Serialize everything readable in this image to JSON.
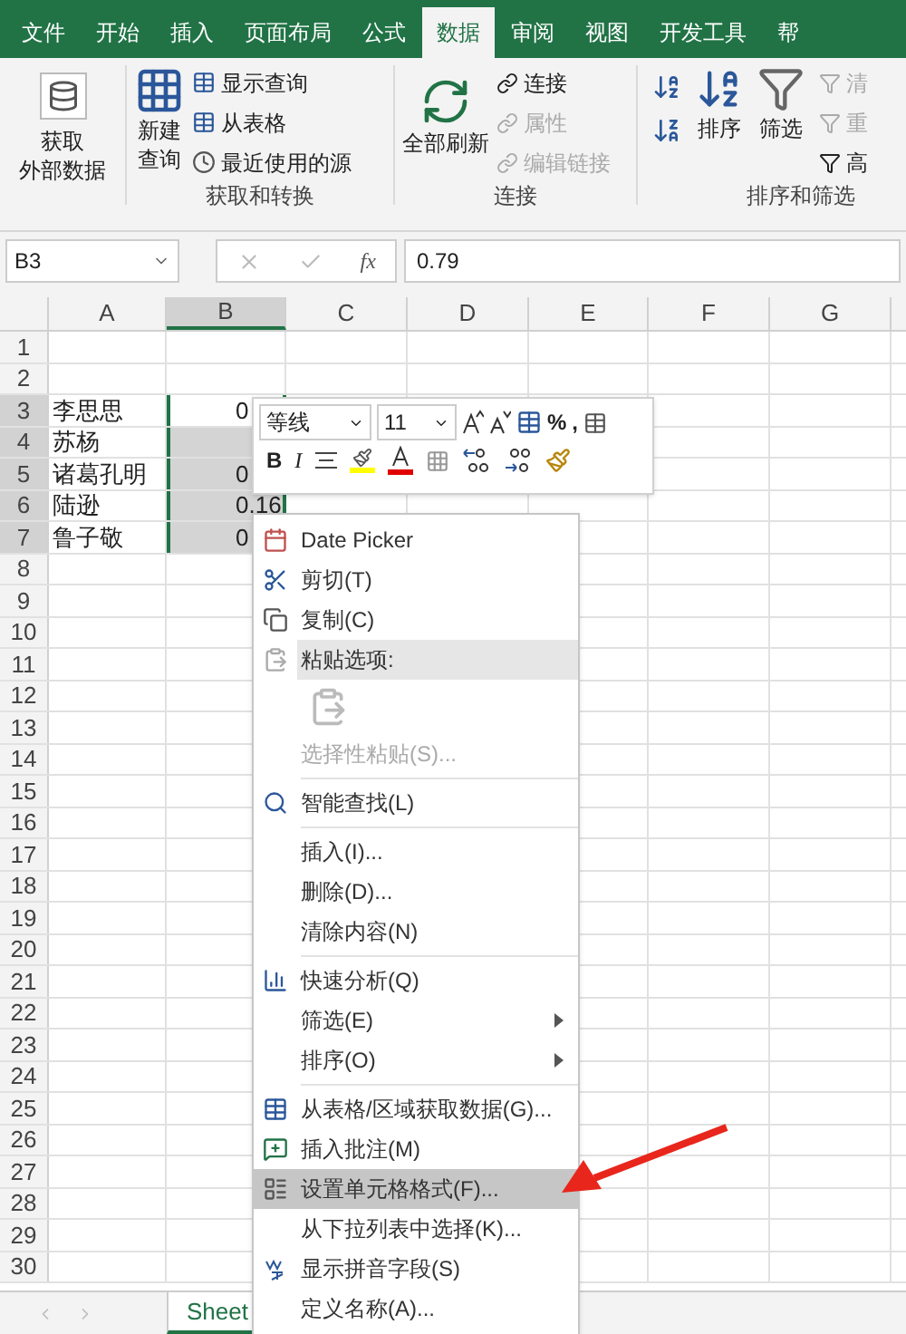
{
  "ribbon_tabs": [
    {
      "label": "文件",
      "selected": false
    },
    {
      "label": "开始",
      "selected": false
    },
    {
      "label": "插入",
      "selected": false
    },
    {
      "label": "页面布局",
      "selected": false
    },
    {
      "label": "公式",
      "selected": false
    },
    {
      "label": "数据",
      "selected": true
    },
    {
      "label": "审阅",
      "selected": false
    },
    {
      "label": "视图",
      "selected": false
    },
    {
      "label": "开发工具",
      "selected": false
    },
    {
      "label": "帮",
      "selected": false
    }
  ],
  "get_external_data": {
    "lines": [
      "获取",
      "外部数据"
    ]
  },
  "get_transform": {
    "new_query": [
      "新建",
      "查询"
    ],
    "items": [
      {
        "label": "显示查询",
        "disabled": false
      },
      {
        "label": "从表格",
        "disabled": false
      },
      {
        "label": "最近使用的源",
        "disabled": false
      }
    ],
    "group_label": "获取和转换"
  },
  "connections": {
    "refresh_all": "全部刷新",
    "items": [
      {
        "label": "连接",
        "disabled": false
      },
      {
        "label": "属性",
        "disabled": true
      },
      {
        "label": "编辑链接",
        "disabled": true
      }
    ],
    "group_label": "连接"
  },
  "sort_filter": {
    "sort": "排序",
    "filter": "筛选",
    "items": [
      {
        "label": "清",
        "disabled": true
      },
      {
        "label": "重",
        "disabled": true
      },
      {
        "label": "高",
        "disabled": false
      }
    ],
    "group_label": "排序和筛选"
  },
  "formula_bar": {
    "name_box": "B3",
    "function_label": "fx",
    "value": "0.79"
  },
  "columns": [
    {
      "label": "A",
      "selected": false
    },
    {
      "label": "B",
      "selected": true
    },
    {
      "label": "C",
      "selected": false
    },
    {
      "label": "D",
      "selected": false
    },
    {
      "label": "E",
      "selected": false
    },
    {
      "label": "F",
      "selected": false
    },
    {
      "label": "G",
      "selected": false
    }
  ],
  "rows": [
    {
      "header": "1",
      "selected": false
    },
    {
      "header": "2",
      "selected": false
    },
    {
      "header": "3",
      "selected": true,
      "active": true,
      "cells": [
        "李思思",
        "0"
      ]
    },
    {
      "header": "4",
      "selected": true,
      "active": false,
      "cells": [
        "苏杨"
      ]
    },
    {
      "header": "5",
      "selected": true,
      "active": false,
      "cells": [
        "诸葛孔明",
        "0"
      ]
    },
    {
      "header": "6",
      "selected": true,
      "active": false,
      "cells": [
        "陆逊",
        "0.16"
      ]
    },
    {
      "header": "7",
      "selected": true,
      "active": false,
      "cells": [
        "鲁子敬",
        "0"
      ]
    },
    {
      "header": "8",
      "selected": false
    },
    {
      "header": "9",
      "selected": false
    },
    {
      "header": "10",
      "selected": false
    },
    {
      "header": "11",
      "selected": false
    },
    {
      "header": "12",
      "selected": false
    },
    {
      "header": "13",
      "selected": false
    },
    {
      "header": "14",
      "selected": false
    },
    {
      "header": "15",
      "selected": false
    },
    {
      "header": "16",
      "selected": false
    },
    {
      "header": "17",
      "selected": false
    },
    {
      "header": "18",
      "selected": false
    },
    {
      "header": "19",
      "selected": false
    },
    {
      "header": "20",
      "selected": false
    },
    {
      "header": "21",
      "selected": false
    },
    {
      "header": "22",
      "selected": false
    },
    {
      "header": "23",
      "selected": false
    },
    {
      "header": "24",
      "selected": false
    },
    {
      "header": "25",
      "selected": false
    },
    {
      "header": "26",
      "selected": false
    },
    {
      "header": "27",
      "selected": false
    },
    {
      "header": "28",
      "selected": false
    },
    {
      "header": "29",
      "selected": false
    },
    {
      "header": "30",
      "selected": false
    }
  ],
  "mini_toolbar": {
    "font": "等线",
    "size": "11",
    "percent": "%",
    "comma": ",",
    "bold": "B",
    "italic": "I"
  },
  "context_menu": [
    {
      "kind": "item",
      "label": "Date Picker",
      "selected": false,
      "disabled": false,
      "submenu": false
    },
    {
      "kind": "item",
      "label": "剪切(T)",
      "selected": false,
      "disabled": false,
      "submenu": false
    },
    {
      "kind": "item",
      "label": "复制(C)",
      "selected": false,
      "disabled": false,
      "submenu": false
    },
    {
      "kind": "header",
      "label": "粘贴选项:"
    },
    {
      "kind": "paste_icons"
    },
    {
      "kind": "item",
      "label": "选择性粘贴(S)...",
      "selected": false,
      "disabled": true,
      "submenu": false
    },
    {
      "kind": "separator"
    },
    {
      "kind": "item",
      "label": "智能查找(L)",
      "selected": false,
      "disabled": false,
      "submenu": false
    },
    {
      "kind": "separator"
    },
    {
      "kind": "item",
      "label": "插入(I)...",
      "selected": false,
      "disabled": false,
      "submenu": false
    },
    {
      "kind": "item",
      "label": "删除(D)...",
      "selected": false,
      "disabled": false,
      "submenu": false
    },
    {
      "kind": "item",
      "label": "清除内容(N)",
      "selected": false,
      "disabled": false,
      "submenu": false
    },
    {
      "kind": "separator"
    },
    {
      "kind": "item",
      "label": "快速分析(Q)",
      "selected": false,
      "disabled": false,
      "submenu": false
    },
    {
      "kind": "item",
      "label": "筛选(E)",
      "selected": false,
      "disabled": false,
      "submenu": true
    },
    {
      "kind": "item",
      "label": "排序(O)",
      "selected": false,
      "disabled": false,
      "submenu": true
    },
    {
      "kind": "separator"
    },
    {
      "kind": "item",
      "label": "从表格/区域获取数据(G)...",
      "selected": false,
      "disabled": false,
      "submenu": false
    },
    {
      "kind": "item",
      "label": "插入批注(M)",
      "selected": false,
      "disabled": false,
      "submenu": false
    },
    {
      "kind": "item",
      "label": "设置单元格格式(F)...",
      "selected": true,
      "disabled": false,
      "submenu": false
    },
    {
      "kind": "item",
      "label": "从下拉列表中选择(K)...",
      "selected": false,
      "disabled": false,
      "submenu": false
    },
    {
      "kind": "item",
      "label": "显示拼音字段(S)",
      "selected": false,
      "disabled": false,
      "submenu": false
    },
    {
      "kind": "item",
      "label": "定义名称(A)...",
      "selected": false,
      "disabled": false,
      "submenu": false
    }
  ],
  "sheet_tabs": [
    {
      "label": "Sheet",
      "selected": true
    }
  ]
}
